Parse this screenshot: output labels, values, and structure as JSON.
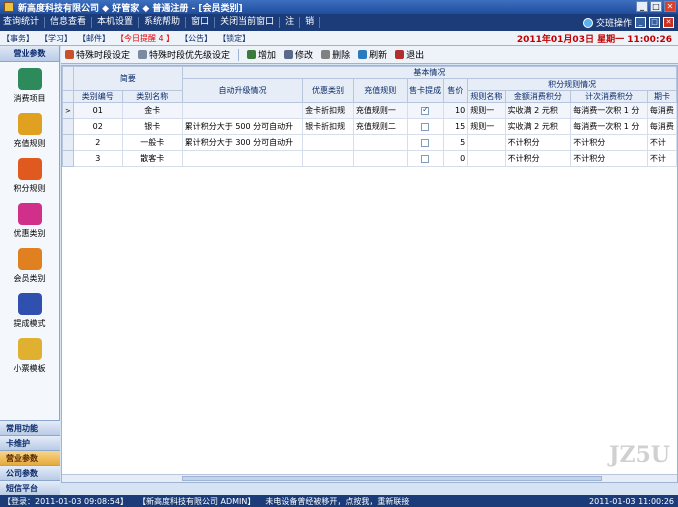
{
  "titlebar": {
    "title": "新高度科技有限公司 ◆ 好管家 ◆  普通注册 - [会员类别]",
    "min": "_",
    "max": "□",
    "close": "✕"
  },
  "menu": {
    "items": [
      "查询统计",
      "信息查看",
      "本机设置",
      "系统帮助",
      "窗口",
      "关闭当前窗口",
      "注",
      "销"
    ],
    "swap_label": "交班操作",
    "min": "_",
    "max": "□",
    "close": "✕"
  },
  "tabs": {
    "items": [
      "【事务】",
      "【学习】",
      "【邮件】"
    ],
    "reminder": "【今日提醒 4 】",
    "items2": [
      "【公告】",
      "【锁定】"
    ],
    "datetime": "2011年01月03日 星期一 11:00:26"
  },
  "sidebar": {
    "header": "营业参数",
    "items": [
      {
        "label": "消费项目",
        "icon": "cash-register-icon",
        "color": "#2d8a5a"
      },
      {
        "label": "充值规则",
        "icon": "coins-icon",
        "color": "#e0a020"
      },
      {
        "label": "积分规则",
        "icon": "gift-icon",
        "color": "#e05a20"
      },
      {
        "label": "优惠类别",
        "icon": "present-icon",
        "color": "#d0308a"
      },
      {
        "label": "会员类别",
        "icon": "users-icon",
        "color": "#e08020"
      },
      {
        "label": "提成模式",
        "icon": "chart-icon",
        "color": "#3050b0"
      },
      {
        "label": "小票模板",
        "icon": "receipt-icon",
        "color": "#e0b030"
      }
    ],
    "categories": [
      "常用功能",
      "卡维护",
      "营业参数",
      "公司参数",
      "短信平台"
    ],
    "active_category": "营业参数"
  },
  "toolbar": {
    "special_period": "特殊时段设定",
    "special_priority": "特殊时段优先级设定",
    "add": "增加",
    "edit": "修改",
    "delete": "删除",
    "refresh": "刷新",
    "exit": "退出"
  },
  "grid": {
    "group_brief": "简要",
    "group_basic": "基本情况",
    "group_points": "积分规则情况",
    "headers": {
      "code": "类别编号",
      "name": "类别名称",
      "upgrade": "自动升级情况",
      "discount": "优惠类别",
      "recharge": "充值规则",
      "commission": "售卡提成",
      "price": "售价",
      "rule_name": "规则名称",
      "amount_points": "金额消费积分",
      "count_points": "计次消费积分",
      "period": "期卡"
    },
    "rows": [
      {
        "indicator": ">",
        "code": "01",
        "name": "金卡",
        "upgrade": "",
        "discount": "金卡折扣规",
        "recharge": "充值规则一",
        "commission": true,
        "price": "10",
        "rule_name": "规则一",
        "amount_points": "实收满 2 元积",
        "count_points": "每消费一次积 1 分",
        "period": "每消费"
      },
      {
        "indicator": "",
        "code": "02",
        "name": "银卡",
        "upgrade": "累计积分大于 500 分可自动升",
        "discount": "银卡折扣规",
        "recharge": "充值规则二",
        "commission": false,
        "price": "15",
        "rule_name": "规则一",
        "amount_points": "实收满 2 元积",
        "count_points": "每消费一次积 1 分",
        "period": "每消费"
      },
      {
        "indicator": "",
        "code": "2",
        "name": "一般卡",
        "upgrade": "累计积分大于 300 分可自动升",
        "discount": "",
        "recharge": "",
        "commission": false,
        "price": "5",
        "rule_name": "",
        "amount_points": "不计积分",
        "count_points": "不计积分",
        "period": "不计"
      },
      {
        "indicator": "",
        "code": "3",
        "name": "散客卡",
        "upgrade": "",
        "discount": "",
        "recharge": "",
        "commission": false,
        "price": "0",
        "rule_name": "",
        "amount_points": "不计积分",
        "count_points": "不计积分",
        "period": "不计"
      }
    ]
  },
  "status": {
    "login": "【登录：2011-01-03 09:08:54】",
    "company": "【新高度科技有限公司  ADMIN】",
    "message": "未电设备曾经被移开，点按我，重新联接",
    "right": "2011-01-03 11:00:26"
  },
  "watermark": "JZ5U"
}
